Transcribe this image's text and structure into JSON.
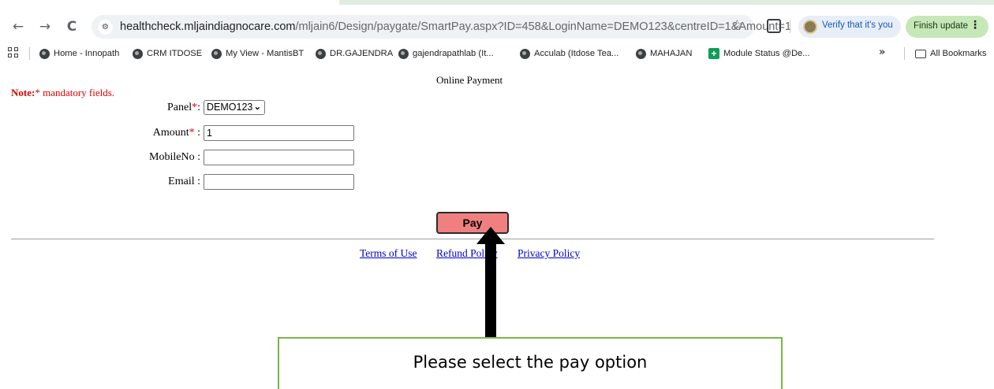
{
  "browser": {
    "url_host": "healthcheck.mljaindiagnocare.com",
    "url_path": "/mljain6/Design/paygate/SmartPay.aspx?ID=458&LoginName=DEMO123&centreID=1&Amount=1",
    "verify_label": "Verify that it's you",
    "finish_update_label": "Finish update",
    "icons": [
      "back-icon",
      "forward-icon",
      "reload-icon",
      "site-info-icon",
      "star-icon",
      "extensions-icon",
      "menu-dots-icon"
    ]
  },
  "bookmarks": {
    "items": [
      {
        "label": "Home - Innopath",
        "icon": "globe-icon"
      },
      {
        "label": "CRM ITDOSE",
        "icon": "globe-icon"
      },
      {
        "label": "My View - MantisBT",
        "icon": "globe-icon"
      },
      {
        "label": "DR.GAJENDRA",
        "icon": "globe-icon"
      },
      {
        "label": "gajendrapathlab (It...",
        "icon": "globe-icon"
      },
      {
        "label": "Acculab (Itdose Tea...",
        "icon": "globe-icon"
      },
      {
        "label": "MAHAJAN",
        "icon": "globe-icon"
      },
      {
        "label": "Module Status @De...",
        "icon": "sheets-plus-icon"
      }
    ],
    "overflow": "»",
    "all_bookmarks": "All Bookmarks"
  },
  "page": {
    "title": "Online Payment",
    "note_prefix": "Note:",
    "note_star": "*",
    "note_text": " mandatory fields.",
    "form": {
      "panel_label": "Panel",
      "panel_value": "DEMO123",
      "amount_label": "Amount",
      "amount_value": "1",
      "mobile_label": "MobileNo",
      "mobile_value": "",
      "email_label": "Email",
      "email_value": "",
      "required_mark": "*"
    },
    "pay_label": "Pay",
    "footer": {
      "terms": "Terms of Use",
      "refund": "Refund Policy",
      "privacy": "Privacy Policy"
    }
  },
  "annotation": {
    "text": "Please select the pay option",
    "border_color": "#7ab648"
  }
}
